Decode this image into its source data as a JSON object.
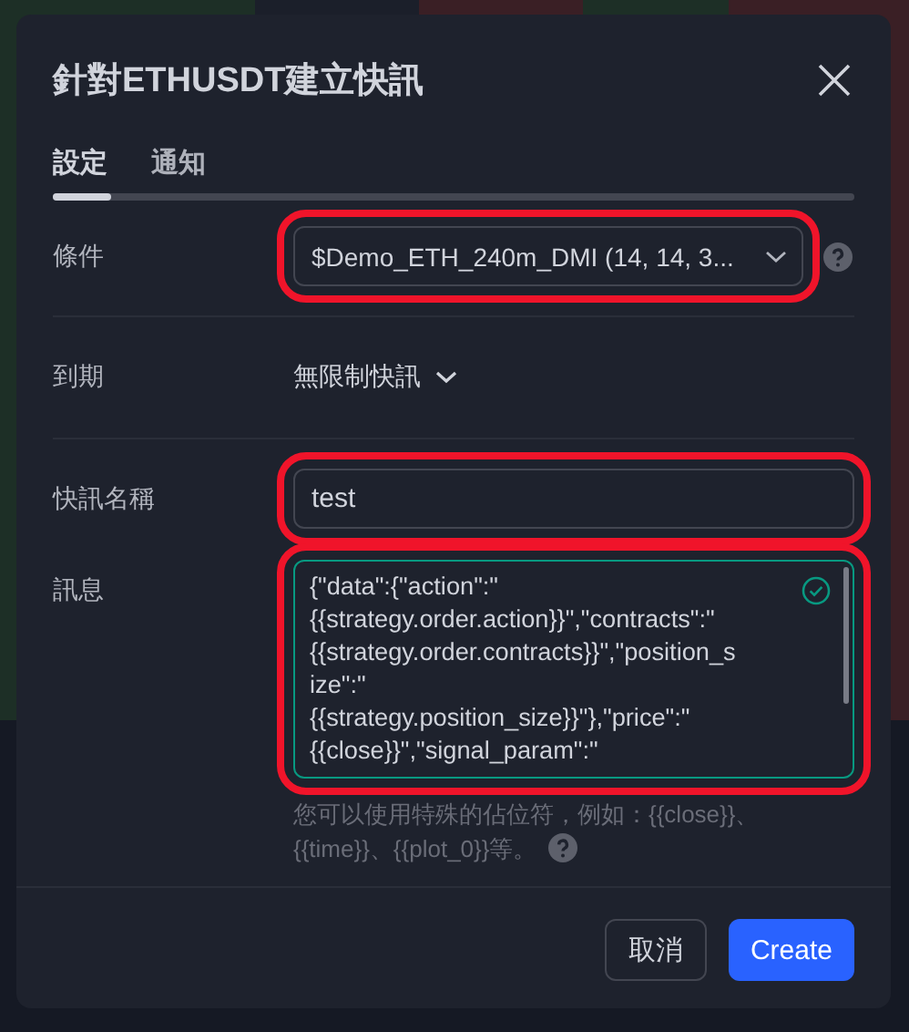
{
  "dialog": {
    "title": "針對ETHUSDT建立快訊"
  },
  "tabs": [
    {
      "label": "設定",
      "selected": true
    },
    {
      "label": "通知",
      "selected": false
    }
  ],
  "condition": {
    "label": "條件",
    "value": "$Demo_ETH_240m_DMI (14, 14, 3...",
    "highlighted": true
  },
  "expiry": {
    "label": "到期",
    "value": "無限制快訊"
  },
  "alert_name": {
    "label": "快訊名稱",
    "value": "test",
    "highlighted": true
  },
  "message": {
    "label": "訊息",
    "highlighted": true,
    "valid": true,
    "lines": [
      "{\"data\":{\"action\":\"",
      "{{strategy.order.action}}\",\"contracts\":\"",
      "{{strategy.order.contracts}}\",\"position_s",
      "ize\":\"",
      "{{strategy.position_size}}\"},\"price\":\"",
      "{{close}}\",\"signal_param\":\""
    ],
    "hint": "您可以使用特殊的佔位符，例如：{{close}}、{{time}}、{{plot_0}}等。"
  },
  "buttons": [
    {
      "label": "取消",
      "kind": "secondary"
    },
    {
      "label": "Create",
      "kind": "primary"
    }
  ]
}
